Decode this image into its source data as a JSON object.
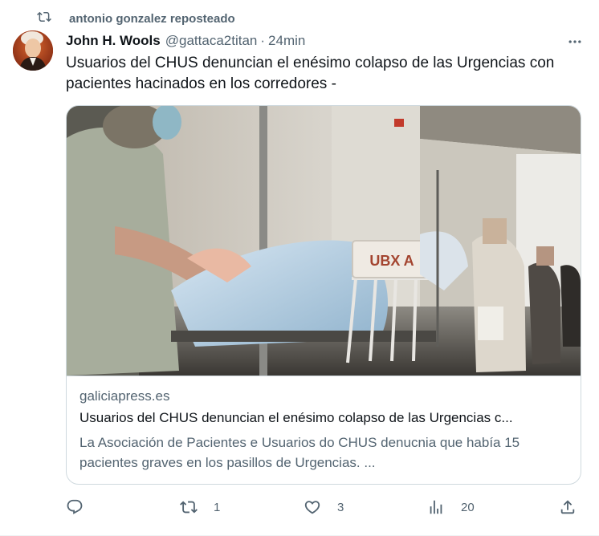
{
  "repost": {
    "label": "antonio gonzalez reposteado"
  },
  "author": {
    "name": "John H. Wools",
    "handle": "@gattaca2titan",
    "separator": "·",
    "time": "24min"
  },
  "tweet": {
    "text": "Usuarios del CHUS denuncian el enésimo colapso de las Urgencias con pacientes hacinados en los corredores -"
  },
  "card": {
    "image_sign": "UBX A",
    "domain": "galiciapress.es",
    "title": "Usuarios del CHUS denuncian el enésimo colapso de las Urgencias c...",
    "description": "La Asociación de Pacientes e Usuarios do CHUS denucnia que había 15 pacientes graves en los pasillos de Urgencias.  ..."
  },
  "actions": {
    "replies": "",
    "reposts": "1",
    "likes": "3",
    "views": "20"
  },
  "icons": [
    "repost-icon",
    "more-icon",
    "reply-icon",
    "like-icon",
    "views-icon",
    "share-icon"
  ],
  "colors": {
    "text": "#0f1419",
    "secondary": "#536471",
    "border": "#cfd9de"
  }
}
